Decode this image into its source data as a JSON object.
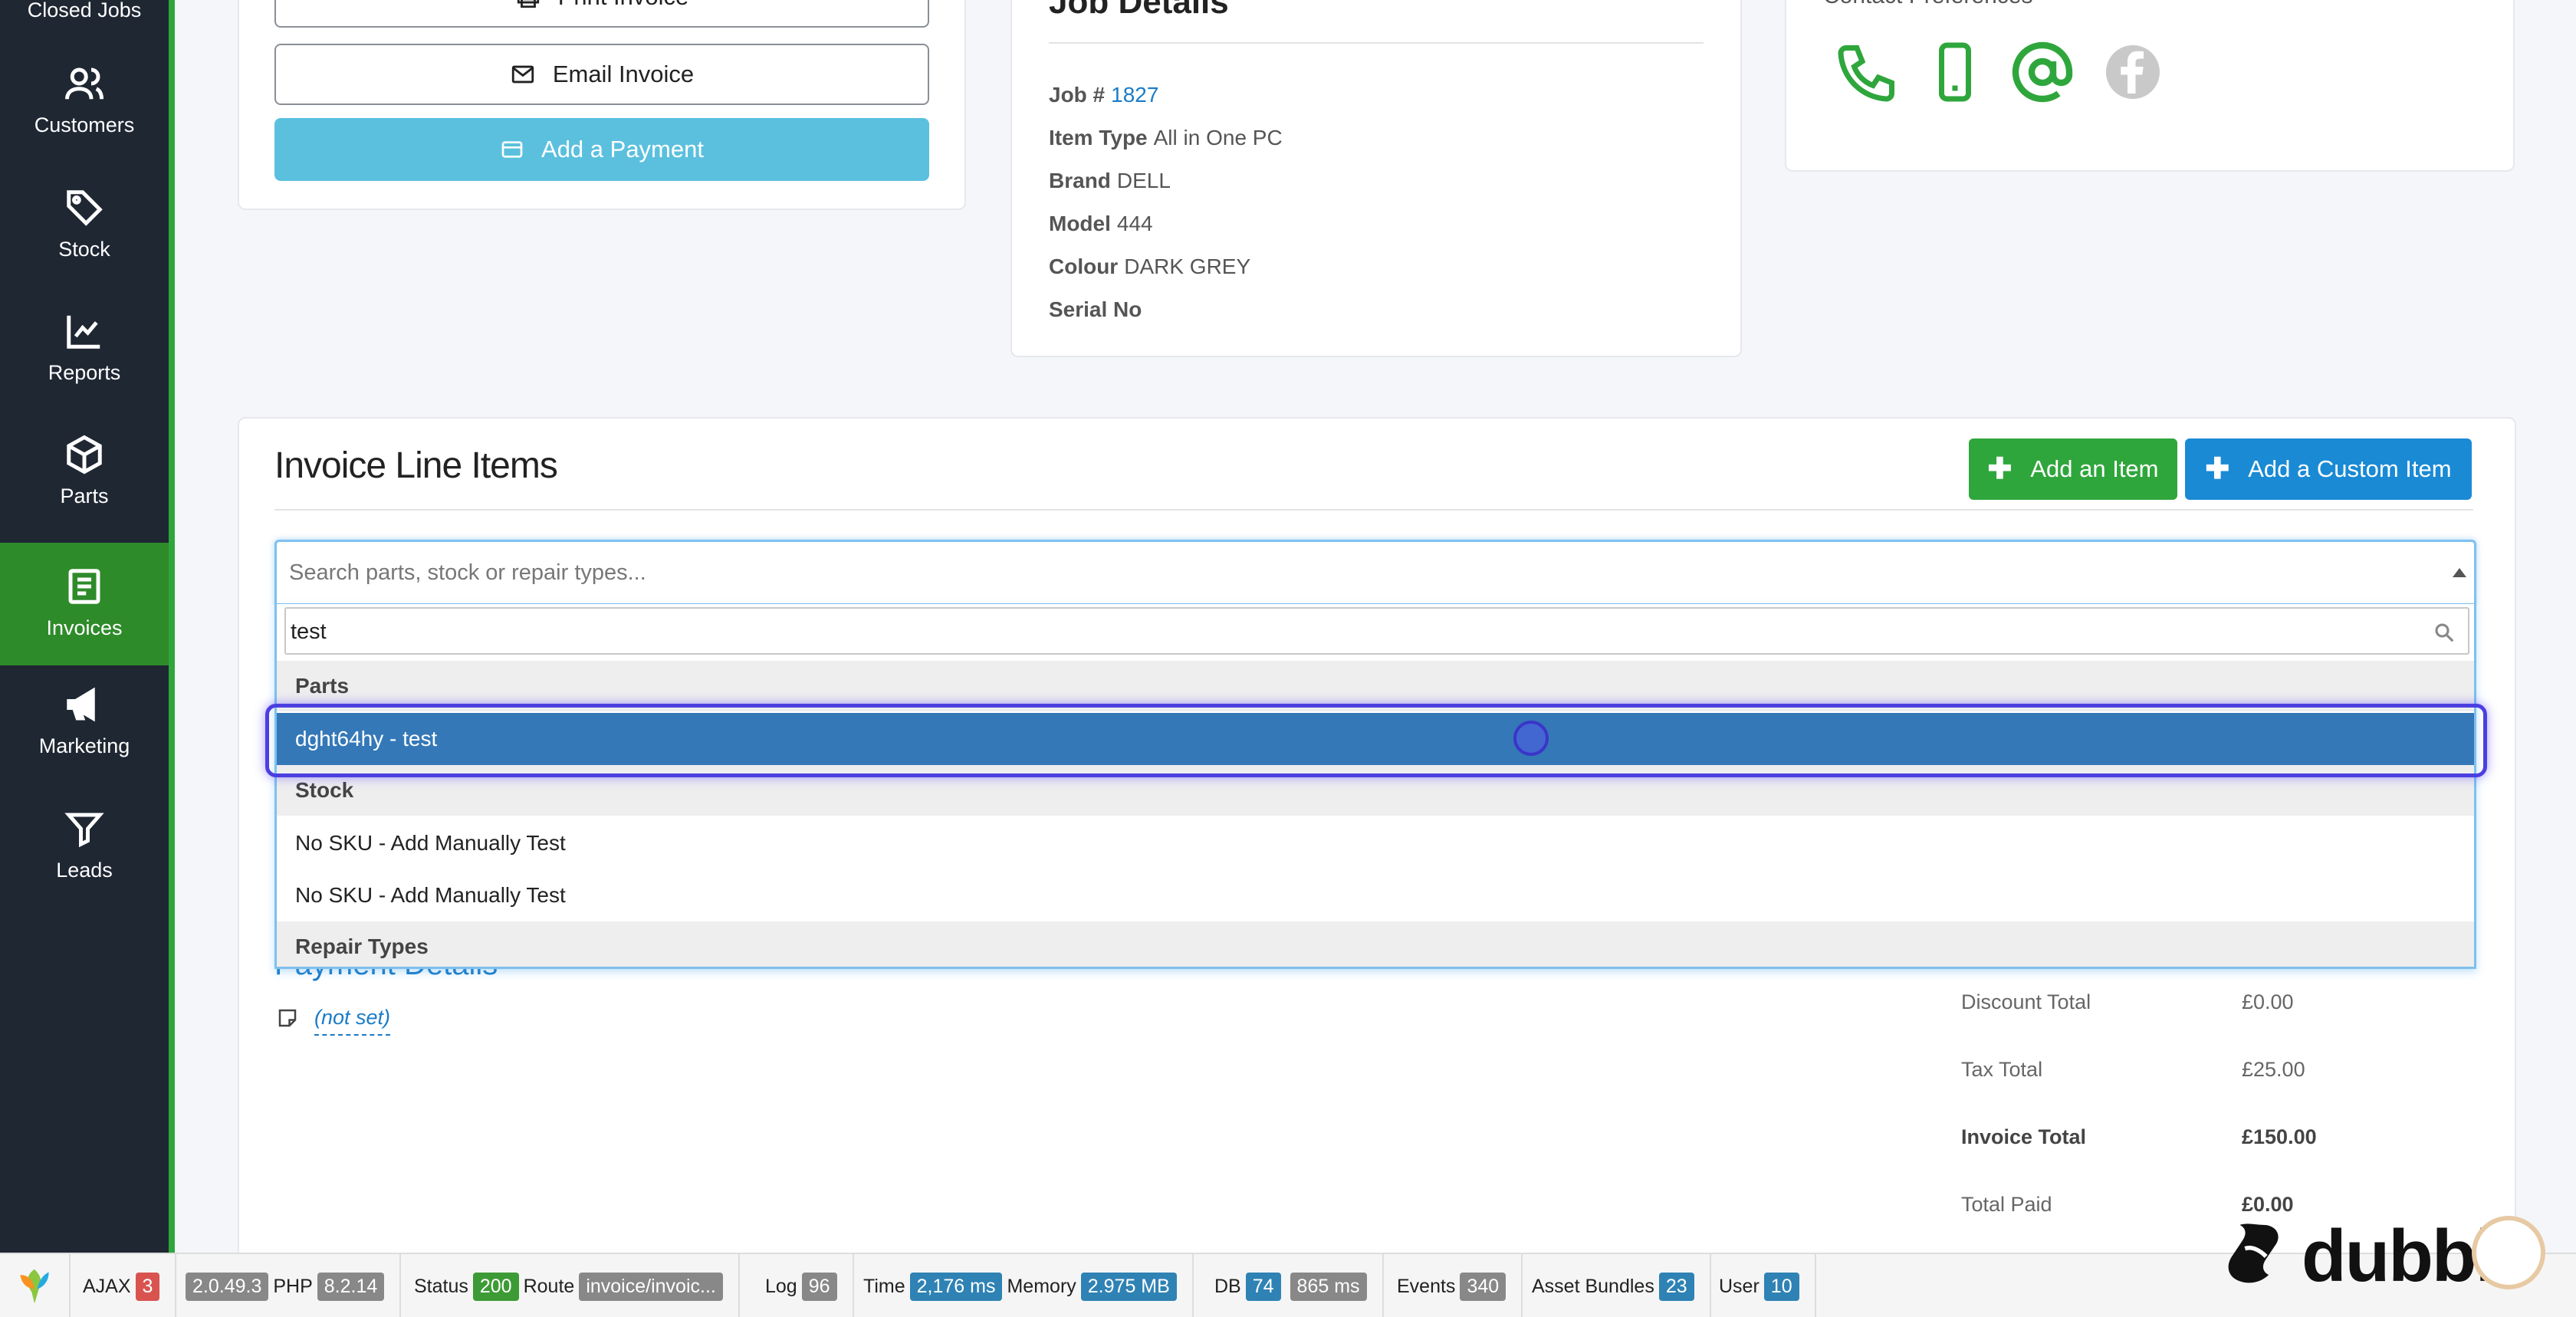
{
  "sidebar": {
    "items": [
      {
        "label": "Closed Jobs",
        "icon": "closed-jobs-icon"
      },
      {
        "label": "Customers",
        "icon": "users-icon"
      },
      {
        "label": "Stock",
        "icon": "tag-icon"
      },
      {
        "label": "Reports",
        "icon": "line-chart-icon"
      },
      {
        "label": "Parts",
        "icon": "box-icon"
      },
      {
        "label": "Invoices",
        "icon": "invoice-icon",
        "active": true
      },
      {
        "label": "Marketing",
        "icon": "megaphone-icon"
      },
      {
        "label": "Leads",
        "icon": "filter-icon"
      }
    ]
  },
  "invoice_actions": {
    "print_label": "Print Invoice",
    "email_label": "Email Invoice",
    "payment_label": "Add a Payment"
  },
  "job_details": {
    "title": "Job Details",
    "job_label": "Job #",
    "job_number": "1827",
    "item_type_label": "Item Type",
    "item_type": "All in One PC",
    "brand_label": "Brand",
    "brand": "DELL",
    "model_label": "Model",
    "model": "444",
    "colour_label": "Colour",
    "colour": "DARK GREY",
    "serial_label": "Serial No",
    "serial": ""
  },
  "contact": {
    "title": "Contact Preferences",
    "icons": [
      "phone-icon",
      "mobile-icon",
      "email-at-icon",
      "facebook-icon"
    ],
    "active_color": "#2fa63c",
    "inactive_color": "#c9c9c9"
  },
  "line_items": {
    "title": "Invoice Line Items",
    "add_item_label": "Add an Item",
    "add_custom_label": "Add a Custom Item",
    "search_placeholder": "Search parts, stock or repair types...",
    "search_value": "test",
    "groups": {
      "parts": "Parts",
      "stock": "Stock",
      "repair_types": "Repair Types"
    },
    "parts_options": [
      "dght64hy - test"
    ],
    "stock_options": [
      "No SKU - Add Manually Test",
      "No SKU - Add Manually Test"
    ]
  },
  "payment_details": {
    "title": "Payment Details",
    "note_value": "(not set)"
  },
  "totals": {
    "discount_label": "Discount Total",
    "discount_value": "£0.00",
    "tax_label": "Tax Total",
    "tax_value": "£25.00",
    "invoice_label": "Invoice Total",
    "invoice_value": "£150.00",
    "paid_label": "Total Paid",
    "paid_value": "£0.00"
  },
  "debug_bar": {
    "ajax_label": "AJAX",
    "ajax_count": "3",
    "yii_version": "2.0.49.3",
    "php_label": "PHP",
    "php_version": "8.2.14",
    "status_label": "Status",
    "status_code": "200",
    "route_label": "Route",
    "route_value": "invoice/invoic...",
    "log_label": "Log",
    "log_count": "96",
    "time_label": "Time",
    "time_value": "2,176 ms",
    "memory_label": "Memory",
    "memory_value": "2.975 MB",
    "db_label": "DB",
    "db_count": "74",
    "db_time": "865 ms",
    "events_label": "Events",
    "events_count": "340",
    "assets_label": "Asset Bundles",
    "assets_count": "23",
    "user_label": "User",
    "user_count": "10"
  },
  "watermark": {
    "brand": "dubble"
  }
}
